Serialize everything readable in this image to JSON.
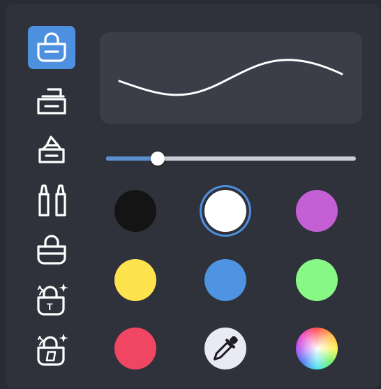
{
  "tools": [
    {
      "name": "bucket-fill-tool",
      "icon": "bucket-icon",
      "active": true
    },
    {
      "name": "eraser-tool",
      "icon": "eraser-icon",
      "active": false
    },
    {
      "name": "pen-tool",
      "icon": "pen-nib-icon",
      "active": false
    },
    {
      "name": "markers-tool",
      "icon": "markers-icon",
      "active": false
    },
    {
      "name": "bucket-half-fill-tool",
      "icon": "bucket-half-icon",
      "active": false
    },
    {
      "name": "magic-text-tool",
      "icon": "magic-text-bucket-icon",
      "active": false,
      "label": "T"
    },
    {
      "name": "magic-shape-tool",
      "icon": "magic-shape-bucket-icon",
      "active": false
    }
  ],
  "brush_size": 0.2,
  "colors": {
    "accent": "#4d90e0",
    "panel": "#2f313b",
    "preview_bg": "#3b3e49",
    "stroke": "#ffffff"
  },
  "swatches": [
    {
      "name": "black",
      "color": "#141414",
      "selected": false
    },
    {
      "name": "white",
      "color": "#ffffff",
      "selected": true
    },
    {
      "name": "purple",
      "color": "#c55fd6",
      "selected": false
    },
    {
      "name": "yellow",
      "color": "#fde34d",
      "selected": false
    },
    {
      "name": "blue",
      "color": "#4f94e2",
      "selected": false
    },
    {
      "name": "green",
      "color": "#87f786",
      "selected": false
    },
    {
      "name": "red",
      "color": "#f04563",
      "selected": false
    },
    {
      "name": "eyedropper",
      "color": "#eaeaf5",
      "icon": "eyedropper-icon",
      "selected": false
    },
    {
      "name": "color-wheel",
      "color": "conic",
      "icon": "color-wheel-icon",
      "selected": false
    }
  ]
}
